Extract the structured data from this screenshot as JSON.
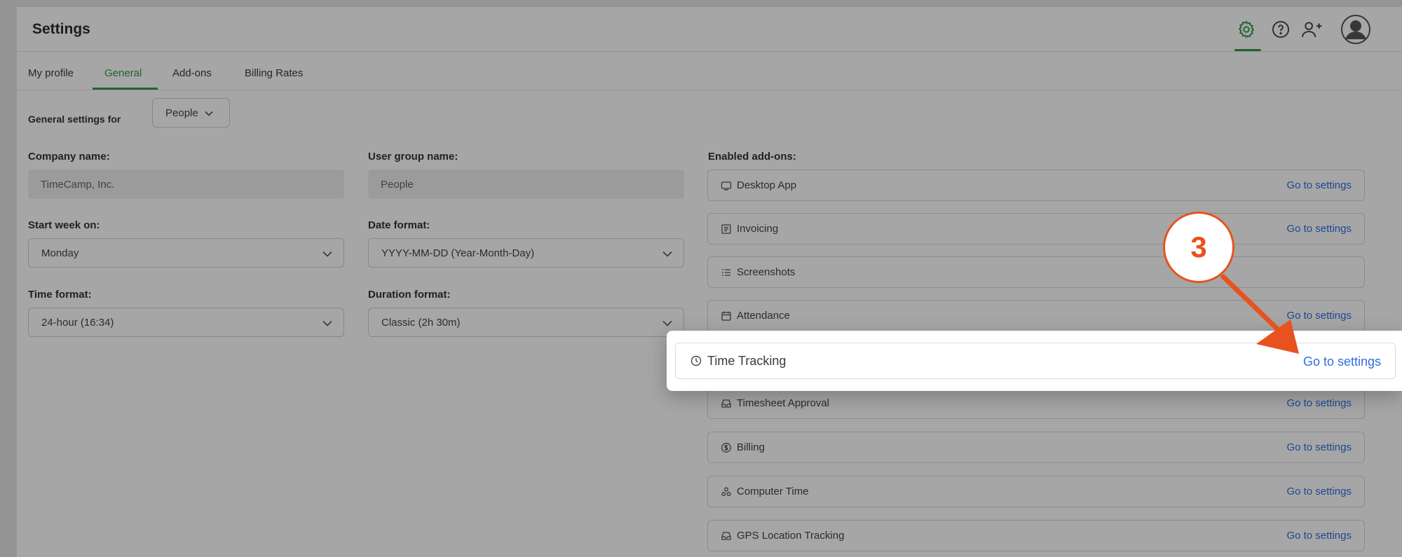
{
  "header": {
    "title": "Settings"
  },
  "tabs": [
    {
      "label": "My profile"
    },
    {
      "label": "General"
    },
    {
      "label": "Add-ons"
    },
    {
      "label": "Billing Rates"
    }
  ],
  "general_settings": {
    "label": "General settings for",
    "selected": "People"
  },
  "fields": {
    "company_name": {
      "label": "Company name:",
      "value": "TimeCamp, Inc."
    },
    "user_group_name": {
      "label": "User group name:",
      "value": "People"
    },
    "start_week": {
      "label": "Start week on:",
      "value": "Monday"
    },
    "date_format": {
      "label": "Date format:",
      "value": "YYYY-MM-DD (Year-Month-Day)"
    },
    "time_format": {
      "label": "Time format:",
      "value": "24-hour (16:34)"
    },
    "duration_format": {
      "label": "Duration format:",
      "value": "Classic (2h 30m)"
    }
  },
  "addons": {
    "label": "Enabled add-ons:",
    "items": [
      {
        "name": "Desktop App",
        "link": "Go to settings",
        "icon": "desktop-icon"
      },
      {
        "name": "Invoicing",
        "link": "Go to settings",
        "icon": "invoice-icon"
      },
      {
        "name": "Screenshots",
        "link": "",
        "icon": "list-icon"
      },
      {
        "name": "Attendance",
        "link": "Go to settings",
        "icon": "calendar-icon"
      },
      {
        "name": "Time Tracking",
        "link": "Go to settings",
        "icon": "clock-icon"
      },
      {
        "name": "Timesheet Approval",
        "link": "Go to settings",
        "icon": "inbox-icon"
      },
      {
        "name": "Billing",
        "link": "Go to settings",
        "icon": "dollar-icon"
      },
      {
        "name": "Computer Time",
        "link": "Go to settings",
        "icon": "apps-icon"
      },
      {
        "name": "GPS Location Tracking",
        "link": "Go to settings",
        "icon": "location-icon"
      }
    ]
  },
  "annotation": {
    "step": "3"
  },
  "colors": {
    "accent": "#2e9a49",
    "link": "#2f6fe0",
    "callout": "#e8521f"
  }
}
